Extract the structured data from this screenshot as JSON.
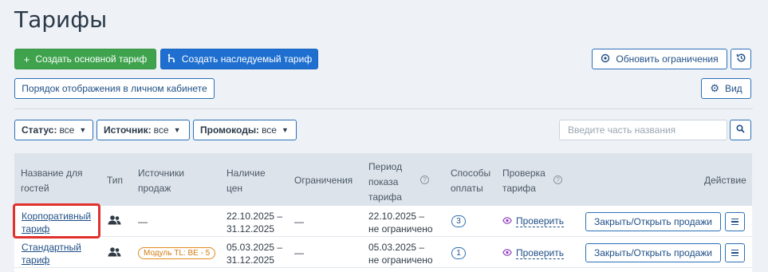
{
  "page": {
    "title": "Тарифы"
  },
  "toolbar": {
    "create_main": "Создать основной тариф",
    "create_inherited": "Создать наследуемый тариф",
    "update_limits": "Обновить ограничения",
    "display_order": "Порядок отображения в личном кабинете",
    "view": "Вид"
  },
  "filters": {
    "status_label": "Статус:",
    "status_value": "все",
    "source_label": "Источник:",
    "source_value": "все",
    "promo_label": "Промокоды:",
    "promo_value": "все"
  },
  "search": {
    "placeholder": "Введите часть названия"
  },
  "table": {
    "headers": {
      "name_1": "Название для",
      "name_2": "гостей",
      "type": "Тип",
      "sources_1": "Источники",
      "sources_2": "продаж",
      "prices_1": "Наличие",
      "prices_2": "цен",
      "limits": "Ограничения",
      "period_1": "Период",
      "period_2": "показа",
      "period_3": "тарифа",
      "payment_1": "Способы",
      "payment_2": "оплаты",
      "check_1": "Проверка",
      "check_2": "тарифа",
      "action": "Действие"
    },
    "rows": [
      {
        "name_1": "Корпоративный",
        "name_2": "тариф",
        "source": "—",
        "prices_1": "22.10.2025 –",
        "prices_2": "31.12.2025",
        "limits": "—",
        "period_1": "22.10.2025 –",
        "period_2": "не ограничено",
        "payment_count": "3",
        "check": "Проверить",
        "action": "Закрыть/Открыть продажи"
      },
      {
        "name_1": "Стандартный",
        "name_2": "тариф",
        "source": "Модуль TL: BE - 5",
        "prices_1": "05.03.2025 –",
        "prices_2": "31.12.2025",
        "limits": "—",
        "period_1": "05.03.2025 –",
        "period_2": "не ограничено",
        "payment_count": "1",
        "check": "Проверить",
        "action": "Закрыть/Открыть продажи"
      }
    ]
  },
  "colors": {
    "primary_green": "#3fa34d",
    "primary_blue": "#1e6fd0",
    "highlight_red": "#e0312c"
  }
}
